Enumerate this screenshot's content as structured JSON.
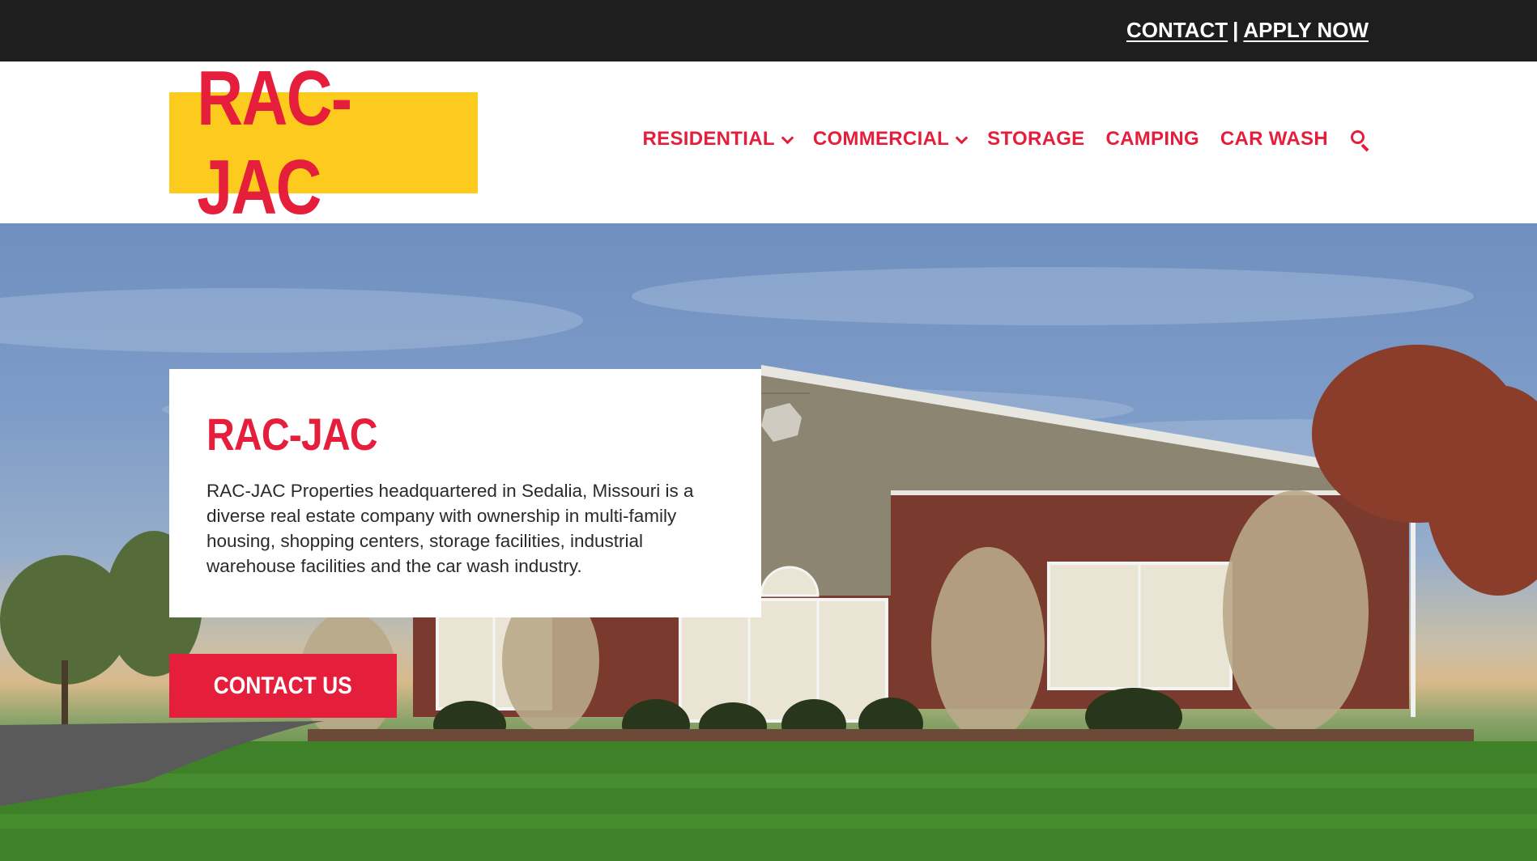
{
  "topbar": {
    "contact": "CONTACT",
    "separator": "|",
    "apply": "APPLY NOW"
  },
  "header": {
    "logo_text": "RAC-JAC",
    "nav": [
      {
        "label": "RESIDENTIAL",
        "has_dropdown": true
      },
      {
        "label": "COMMERCIAL",
        "has_dropdown": true
      },
      {
        "label": "STORAGE",
        "has_dropdown": false
      },
      {
        "label": "CAMPING",
        "has_dropdown": false
      },
      {
        "label": "CAR WASH",
        "has_dropdown": false
      }
    ],
    "search_icon": "search-icon"
  },
  "hero": {
    "title": "RAC-JAC",
    "description": "RAC-JAC Properties headquartered in Sedalia, Missouri is a diverse real estate company with ownership in multi-family housing, shopping centers, storage facilities, industrial warehouse facilities and the car wash industry.",
    "cta": "CONTACT US"
  },
  "colors": {
    "brand_red": "#e41e3b",
    "brand_yellow": "#fdcb1d",
    "topbar_bg": "#1e1e1e"
  }
}
